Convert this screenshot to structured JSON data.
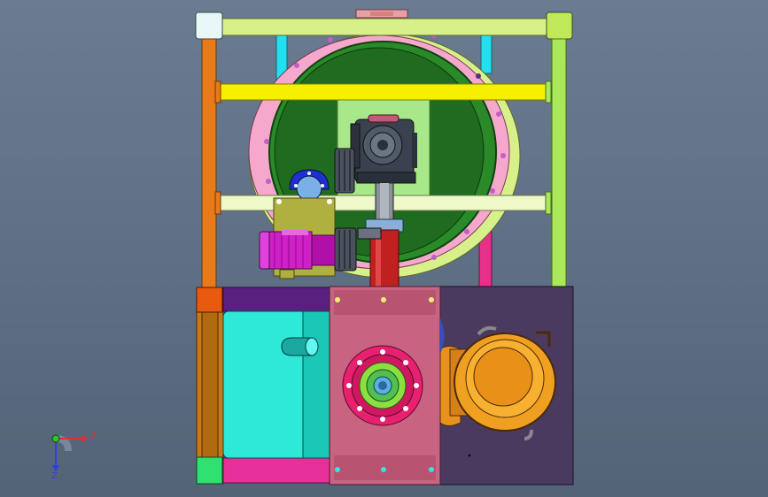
{
  "viewport": {
    "background": "#5e6e83"
  },
  "axis_triad": {
    "x_label": "X",
    "z_label": "Z",
    "x_color": "#e03030",
    "y_color": "#30c030",
    "z_color": "#3040e0"
  },
  "model": {
    "frame_color": "#d8f08a",
    "post_left_color": "#e87a1a",
    "post_right_color": "#a8e85a",
    "tank_color": "#1f6b1f",
    "tank_flange_color": "#f0a0c8",
    "gearbox_color": "#3a4250",
    "shaft_color": "#c02020",
    "motor_color": "#d020c8",
    "center_panel_color": "#c86482",
    "right_panel_color": "#4a3a60",
    "left_panel_color": "#2ee8d8",
    "pump_color": "#f0a020",
    "yellow_beam_color": "#f5f000"
  }
}
